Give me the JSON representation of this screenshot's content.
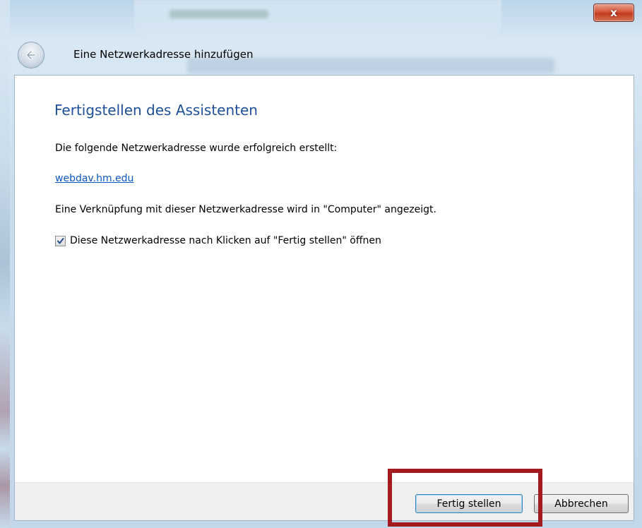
{
  "window": {
    "title": "Eine Netzwerkadresse hinzufügen",
    "close_label": "x"
  },
  "wizard": {
    "heading": "Fertigstellen des Assistenten",
    "success_text": "Die folgende Netzwerkadresse wurde erfolgreich erstellt:",
    "address_link": "webdav.hm.edu",
    "shortcut_text": "Eine Verknüpfung mit dieser Netzwerkadresse wird in \"Computer\" angezeigt.",
    "open_checkbox": {
      "label": "Diese Netzwerkadresse nach Klicken auf \"Fertig stellen\" öffnen",
      "checked": true
    }
  },
  "footer": {
    "finish_label": "Fertig stellen",
    "cancel_label": "Abbrechen"
  },
  "colors": {
    "heading": "#1e4f9a",
    "link": "#0b56c4",
    "highlight": "#a31b1e",
    "close_button": "#c23b1e"
  },
  "icons": {
    "back": "back-arrow-icon",
    "close": "close-icon",
    "check": "check-mark-icon"
  }
}
